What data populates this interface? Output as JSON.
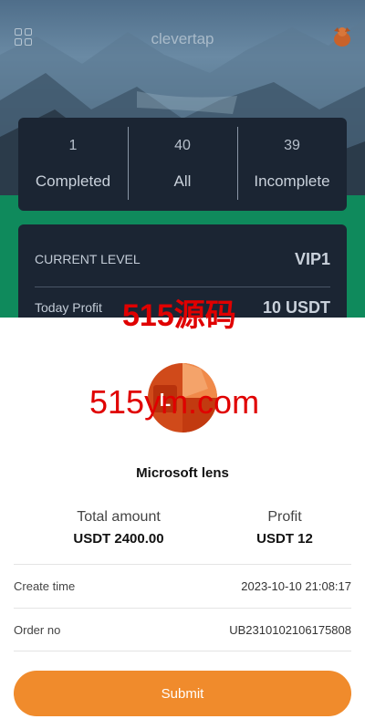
{
  "header": {
    "app_title": "clevertap",
    "menu_icon": "grid-icon",
    "avatar_icon": "avatar-icon"
  },
  "stats": [
    {
      "value": "1",
      "label": "Completed"
    },
    {
      "value": "40",
      "label": "All"
    },
    {
      "value": "39",
      "label": "Incomplete"
    }
  ],
  "level": {
    "current_level_label": "CURRENT LEVEL",
    "current_level_value": "VIP1",
    "today_profit_label": "Today Profit",
    "today_profit_value": "10 USDT"
  },
  "watermarks": {
    "text1": "515源码",
    "text2": "515ym.com"
  },
  "order": {
    "product_icon": "microsoft-lens-logo",
    "product_name": "Microsoft lens",
    "total_amount_label": "Total amount",
    "total_amount_value": "USDT 2400.00",
    "profit_label": "Profit",
    "profit_value": "USDT 12",
    "create_time_label": "Create time",
    "create_time_value": "2023-10-10 21:08:17",
    "order_no_label": "Order no",
    "order_no_value": "UB2310102106175808",
    "submit_label": "Submit"
  },
  "colors": {
    "accent": "#f08b2c",
    "card_bg": "#1b2533",
    "green_band": "#0f8a5c",
    "watermark": "#e00000"
  }
}
